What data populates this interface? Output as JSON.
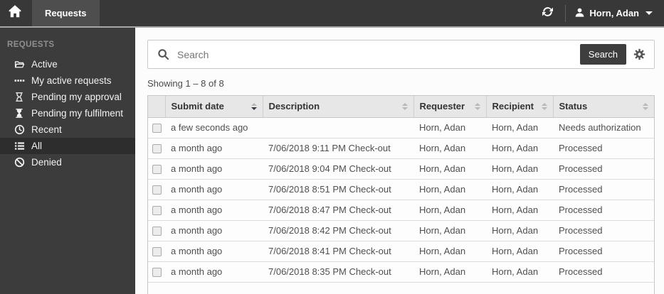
{
  "topbar": {
    "tab_label": "Requests",
    "user_name": "Horn, Adan"
  },
  "sidebar": {
    "header": "REQUESTS",
    "items": [
      {
        "label": "Active",
        "icon": "folder-open-icon",
        "selected": false
      },
      {
        "label": "My active requests",
        "icon": "ellipsis-icon",
        "selected": false
      },
      {
        "label": "Pending my approval",
        "icon": "hourglass-outline-icon",
        "selected": false
      },
      {
        "label": "Pending my fulfilment",
        "icon": "hourglass-filled-icon",
        "selected": false
      },
      {
        "label": "Recent",
        "icon": "clock-icon",
        "selected": false
      },
      {
        "label": "All",
        "icon": "list-icon",
        "selected": true
      },
      {
        "label": "Denied",
        "icon": "ban-icon",
        "selected": false
      }
    ]
  },
  "search": {
    "placeholder": "Search",
    "button_label": "Search"
  },
  "results_summary": "Showing 1 – 8 of 8",
  "table": {
    "columns": [
      {
        "label": "Submit date",
        "sort": "desc"
      },
      {
        "label": "Description",
        "sort": "none"
      },
      {
        "label": "Requester",
        "sort": "none"
      },
      {
        "label": "Recipient",
        "sort": "none"
      },
      {
        "label": "Status",
        "sort": "none"
      }
    ],
    "rows": [
      {
        "submit_date": "a few seconds ago",
        "description": "",
        "requester": "Horn, Adan",
        "recipient": "Horn, Adan",
        "status": "Needs authorization"
      },
      {
        "submit_date": "a month ago",
        "description": "7/06/2018 9:11 PM Check-out",
        "requester": "Horn, Adan",
        "recipient": "Horn, Adan",
        "status": "Processed"
      },
      {
        "submit_date": "a month ago",
        "description": "7/06/2018 9:04 PM Check-out",
        "requester": "Horn, Adan",
        "recipient": "Horn, Adan",
        "status": "Processed"
      },
      {
        "submit_date": "a month ago",
        "description": "7/06/2018 8:51 PM Check-out",
        "requester": "Horn, Adan",
        "recipient": "Horn, Adan",
        "status": "Processed"
      },
      {
        "submit_date": "a month ago",
        "description": "7/06/2018 8:47 PM Check-out",
        "requester": "Horn, Adan",
        "recipient": "Horn, Adan",
        "status": "Processed"
      },
      {
        "submit_date": "a month ago",
        "description": "7/06/2018 8:42 PM Check-out",
        "requester": "Horn, Adan",
        "recipient": "Horn, Adan",
        "status": "Processed"
      },
      {
        "submit_date": "a month ago",
        "description": "7/06/2018 8:41 PM Check-out",
        "requester": "Horn, Adan",
        "recipient": "Horn, Adan",
        "status": "Processed"
      },
      {
        "submit_date": "a month ago",
        "description": "7/06/2018 8:35 PM Check-out",
        "requester": "Horn, Adan",
        "recipient": "Horn, Adan",
        "status": "Processed"
      }
    ]
  },
  "colors": {
    "topbar_bg": "#383838",
    "tab_bg": "#4e4e4e",
    "sidebar_bg": "#3c3c3c",
    "selected_item_bg": "#2d2d2d",
    "separator": "#a6a6a6",
    "button_bg": "#3e3e3e",
    "table_header_bg": "#e7e7e7"
  }
}
